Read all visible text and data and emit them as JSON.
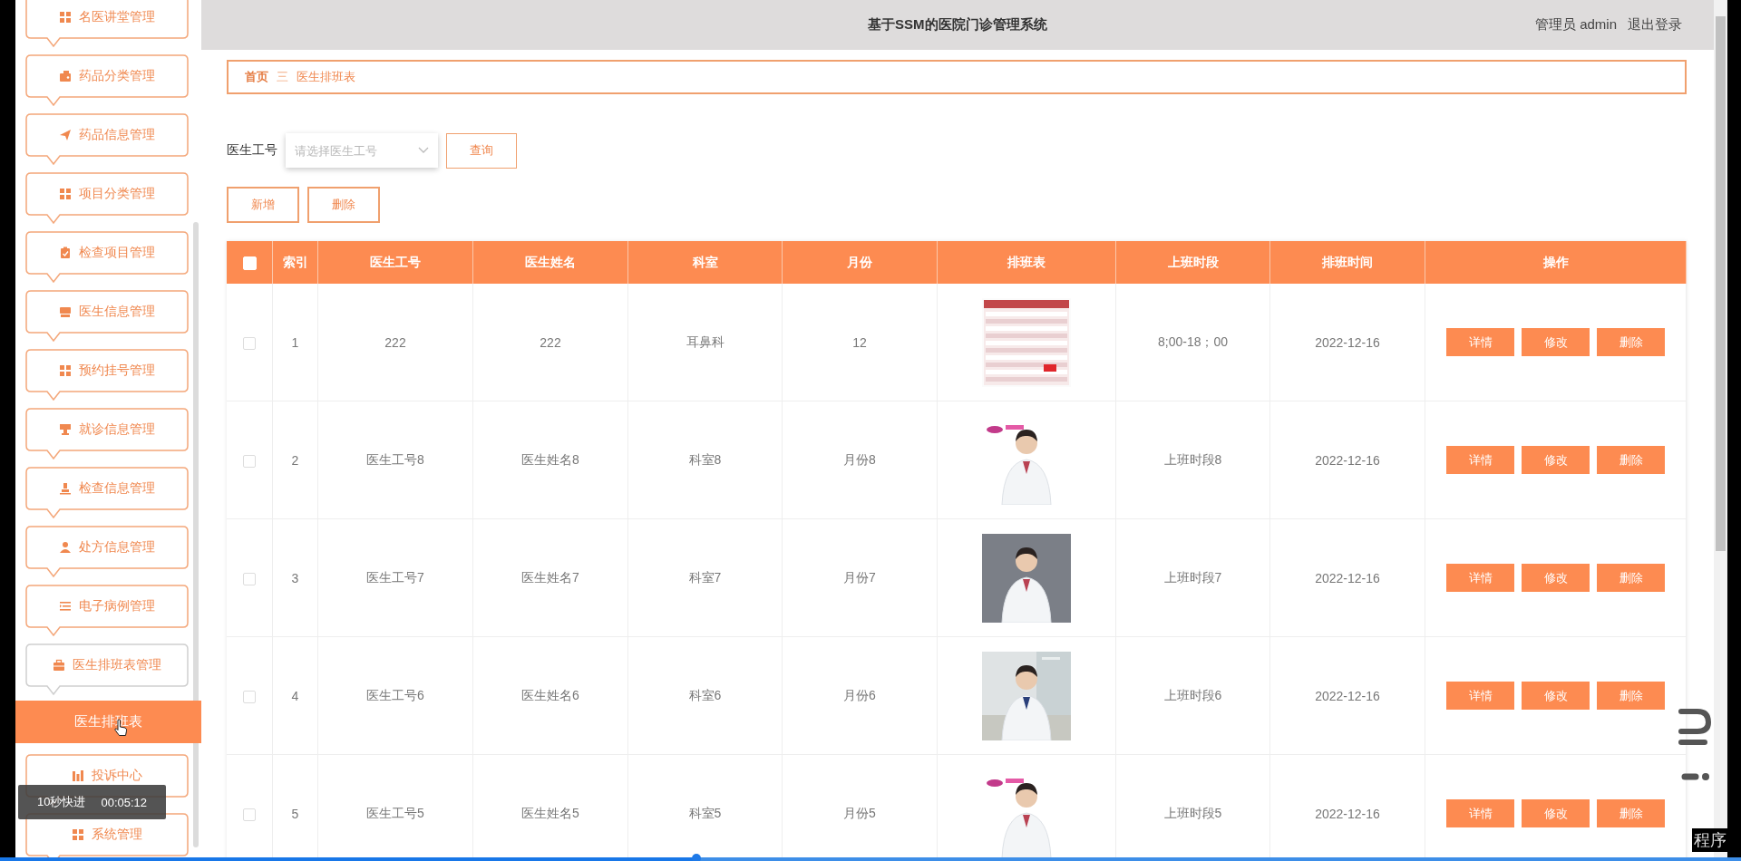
{
  "header": {
    "title": "基于SSM的医院门诊管理系统",
    "user": "管理员 admin",
    "logout": "退出登录"
  },
  "sidebar": {
    "items": [
      {
        "label": "名医讲堂管理",
        "expanded": false
      },
      {
        "label": "药品分类管理",
        "expanded": false
      },
      {
        "label": "药品信息管理",
        "expanded": false
      },
      {
        "label": "项目分类管理",
        "expanded": false
      },
      {
        "label": "检查项目管理",
        "expanded": false
      },
      {
        "label": "医生信息管理",
        "expanded": false
      },
      {
        "label": "预约挂号管理",
        "expanded": false
      },
      {
        "label": "就诊信息管理",
        "expanded": false
      },
      {
        "label": "检查信息管理",
        "expanded": false
      },
      {
        "label": "处方信息管理",
        "expanded": false
      },
      {
        "label": "电子病例管理",
        "expanded": false
      },
      {
        "label": "医生排班表管理",
        "expanded": true,
        "children": [
          {
            "label": "医生排班表",
            "selected": true
          }
        ]
      },
      {
        "label": "投诉中心",
        "expanded": false
      },
      {
        "label": "系统管理",
        "expanded": false
      }
    ]
  },
  "breadcrumb": {
    "items": [
      "首页",
      "医生排班表"
    ],
    "separator": "三"
  },
  "search": {
    "label": "医生工号",
    "placeholder": "请选择医生工号",
    "button": "查询"
  },
  "toolbar": [
    "新增",
    "删除"
  ],
  "table": {
    "select_all": {
      "checked": false
    },
    "columns": [
      "索引",
      "医生工号",
      "医生姓名",
      "科室",
      "月份",
      "排班表",
      "上班时段",
      "排班时间",
      "操作"
    ],
    "rows": [
      {
        "checked": false,
        "index": "1",
        "doctor_id": "222",
        "doctor_name": "222",
        "department": "耳鼻科",
        "month": "12",
        "shift": "8;00-18；00",
        "date": "2022-12-16",
        "actions": [
          "详情",
          "修改",
          "删除"
        ]
      },
      {
        "checked": false,
        "index": "2",
        "doctor_id": "医生工号8",
        "doctor_name": "医生姓名8",
        "department": "科室8",
        "month": "月份8",
        "shift": "上班时段8",
        "date": "2022-12-16",
        "actions": [
          "详情",
          "修改",
          "删除"
        ]
      },
      {
        "checked": false,
        "index": "3",
        "doctor_id": "医生工号7",
        "doctor_name": "医生姓名7",
        "department": "科室7",
        "month": "月份7",
        "shift": "上班时段7",
        "date": "2022-12-16",
        "actions": [
          "详情",
          "修改",
          "删除"
        ]
      },
      {
        "checked": false,
        "index": "4",
        "doctor_id": "医生工号6",
        "doctor_name": "医生姓名6",
        "department": "科室6",
        "month": "月份6",
        "shift": "上班时段6",
        "date": "2022-12-16",
        "actions": [
          "详情",
          "修改",
          "删除"
        ]
      },
      {
        "checked": false,
        "index": "5",
        "doctor_id": "医生工号5",
        "doctor_name": "医生姓名5",
        "department": "科室5",
        "month": "月份5",
        "shift": "上班时段5",
        "date": "2022-12-16",
        "actions": [
          "详情",
          "修改",
          "删除"
        ]
      }
    ]
  },
  "player": {
    "overlay": "10秒快进",
    "time": "00:05:12",
    "level": 0.4
  },
  "corner_text": "程序"
}
